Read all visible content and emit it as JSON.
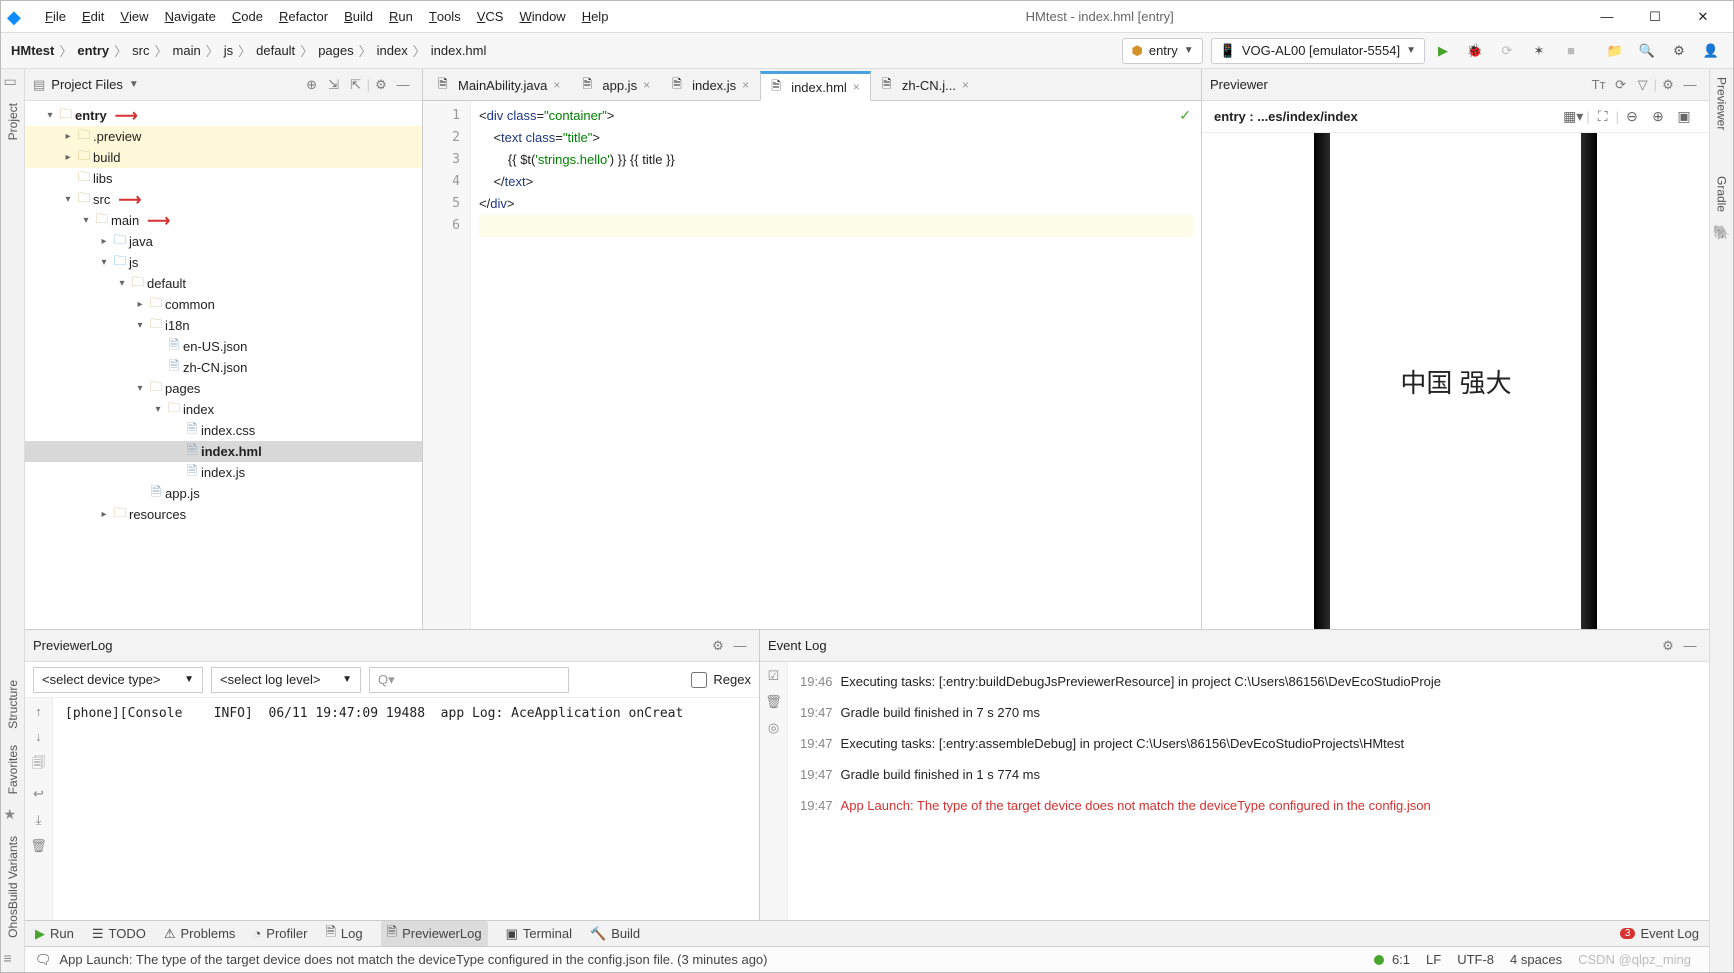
{
  "window_title": "HMtest - index.hml [entry]",
  "menus": [
    "File",
    "Edit",
    "View",
    "Navigate",
    "Code",
    "Refactor",
    "Build",
    "Run",
    "Tools",
    "VCS",
    "Window",
    "Help"
  ],
  "breadcrumbs": [
    "HMtest",
    "entry",
    "src",
    "main",
    "js",
    "default",
    "pages",
    "index",
    "index.hml"
  ],
  "config_combo": "entry",
  "device_combo": "VOG-AL00 [emulator-5554]",
  "left_strip": {
    "project": "Project",
    "structure": "Structure",
    "favorites": "Favorites",
    "variants": "OhosBuild Variants"
  },
  "right_strip": {
    "previewer": "Previewer",
    "gradle": "Gradle"
  },
  "project_panel": {
    "title": "Project Files"
  },
  "tree": [
    {
      "depth": 0,
      "arrow": "down",
      "icon": "folder",
      "name": "entry",
      "bold": true,
      "annot": true
    },
    {
      "depth": 1,
      "arrow": "right",
      "icon": "folder",
      "name": ".preview",
      "hl": true
    },
    {
      "depth": 1,
      "arrow": "right",
      "icon": "folder",
      "name": "build",
      "hl": true
    },
    {
      "depth": 1,
      "arrow": "none",
      "icon": "folder",
      "name": "libs"
    },
    {
      "depth": 1,
      "arrow": "down",
      "icon": "folder",
      "name": "src",
      "annot": true
    },
    {
      "depth": 2,
      "arrow": "down",
      "icon": "folder",
      "name": "main",
      "annot": true
    },
    {
      "depth": 3,
      "arrow": "right",
      "icon": "bfolder",
      "name": "java"
    },
    {
      "depth": 3,
      "arrow": "down",
      "icon": "bfolder",
      "name": "js"
    },
    {
      "depth": 4,
      "arrow": "down",
      "icon": "folder",
      "name": "default"
    },
    {
      "depth": 5,
      "arrow": "right",
      "icon": "folder",
      "name": "common"
    },
    {
      "depth": 5,
      "arrow": "down",
      "icon": "folder",
      "name": "i18n"
    },
    {
      "depth": 6,
      "arrow": "none",
      "icon": "file",
      "name": "en-US.json"
    },
    {
      "depth": 6,
      "arrow": "none",
      "icon": "file",
      "name": "zh-CN.json"
    },
    {
      "depth": 5,
      "arrow": "down",
      "icon": "folder",
      "name": "pages"
    },
    {
      "depth": 6,
      "arrow": "down",
      "icon": "folder",
      "name": "index"
    },
    {
      "depth": 7,
      "arrow": "none",
      "icon": "file",
      "name": "index.css"
    },
    {
      "depth": 7,
      "arrow": "none",
      "icon": "file",
      "name": "index.hml",
      "sel": true,
      "bold": true
    },
    {
      "depth": 7,
      "arrow": "none",
      "icon": "file",
      "name": "index.js"
    },
    {
      "depth": 5,
      "arrow": "none",
      "icon": "file",
      "name": "app.js"
    },
    {
      "depth": 3,
      "arrow": "right",
      "icon": "folder",
      "name": "resources"
    }
  ],
  "tabs": [
    {
      "name": "MainAbility.java",
      "active": false
    },
    {
      "name": "app.js",
      "active": false
    },
    {
      "name": "index.js",
      "active": false
    },
    {
      "name": "index.hml",
      "active": true
    },
    {
      "name": "zh-CN.j...",
      "active": false
    }
  ],
  "code_lines": [
    "1",
    "2",
    "3",
    "4",
    "5",
    "6"
  ],
  "code": {
    "l1a": "<",
    "l1b": "div",
    "l1c": " class",
    "l1d": "=",
    "l1e": "\"container\"",
    "l1f": ">",
    "l2a": "    <",
    "l2b": "text",
    "l2c": " class",
    "l2d": "=",
    "l2e": "\"title\"",
    "l2f": ">",
    "l3": "        {{ $t('strings.hello') }} {{ title }}",
    "l3a": "        {{ $t(",
    "l3b": "'strings.hello'",
    "l3c": ") }} {{ title }}",
    "l4a": "    </",
    "l4b": "text",
    "l4c": ">",
    "l5a": "</",
    "l5b": "div",
    "l5c": ">"
  },
  "previewer_title": "Previewer",
  "previewer_bc": "entry : ...es/index/index",
  "phone_text": "中国 强大",
  "previewer_log_title": "PreviewerLog",
  "event_log_title": "Event Log",
  "device_type_ph": "<select device type>",
  "log_level_ph": "<select log level>",
  "regex_label": "Regex",
  "search_ph": "Q▾",
  "prevlog_line": "[phone][Console    INFO]  06/11 19:47:09 19488  app Log: AceApplication onCreat",
  "events": [
    {
      "t": "19:46",
      "msg": "Executing tasks: [:entry:buildDebugJsPreviewerResource] in project C:\\Users\\86156\\DevEcoStudioProje"
    },
    {
      "t": "19:47",
      "msg": "Gradle build finished in 7 s 270 ms"
    },
    {
      "t": "19:47",
      "msg": "Executing tasks: [:entry:assembleDebug] in project C:\\Users\\86156\\DevEcoStudioProjects\\HMtest"
    },
    {
      "t": "19:47",
      "msg": "Gradle build finished in 1 s 774 ms"
    },
    {
      "t": "19:47",
      "msg": "App Launch: The type of the target device does not match the deviceType configured in the config.json",
      "err": true
    }
  ],
  "bottom_tabs": {
    "run": "Run",
    "todo": "TODO",
    "problems": "Problems",
    "profiler": "Profiler",
    "log": "Log",
    "prevlog": "PreviewerLog",
    "terminal": "Terminal",
    "build": "Build",
    "eventlog": "Event Log",
    "badge": "3"
  },
  "status": {
    "msg": "App Launch: The type of the target device does not match the deviceType configured in the config.json file. (3 minutes ago)",
    "pos": "6:1",
    "lf": "LF",
    "enc": "UTF-8",
    "spaces": "4 spaces",
    "watermark": "CSDN @qlpz_ming"
  }
}
